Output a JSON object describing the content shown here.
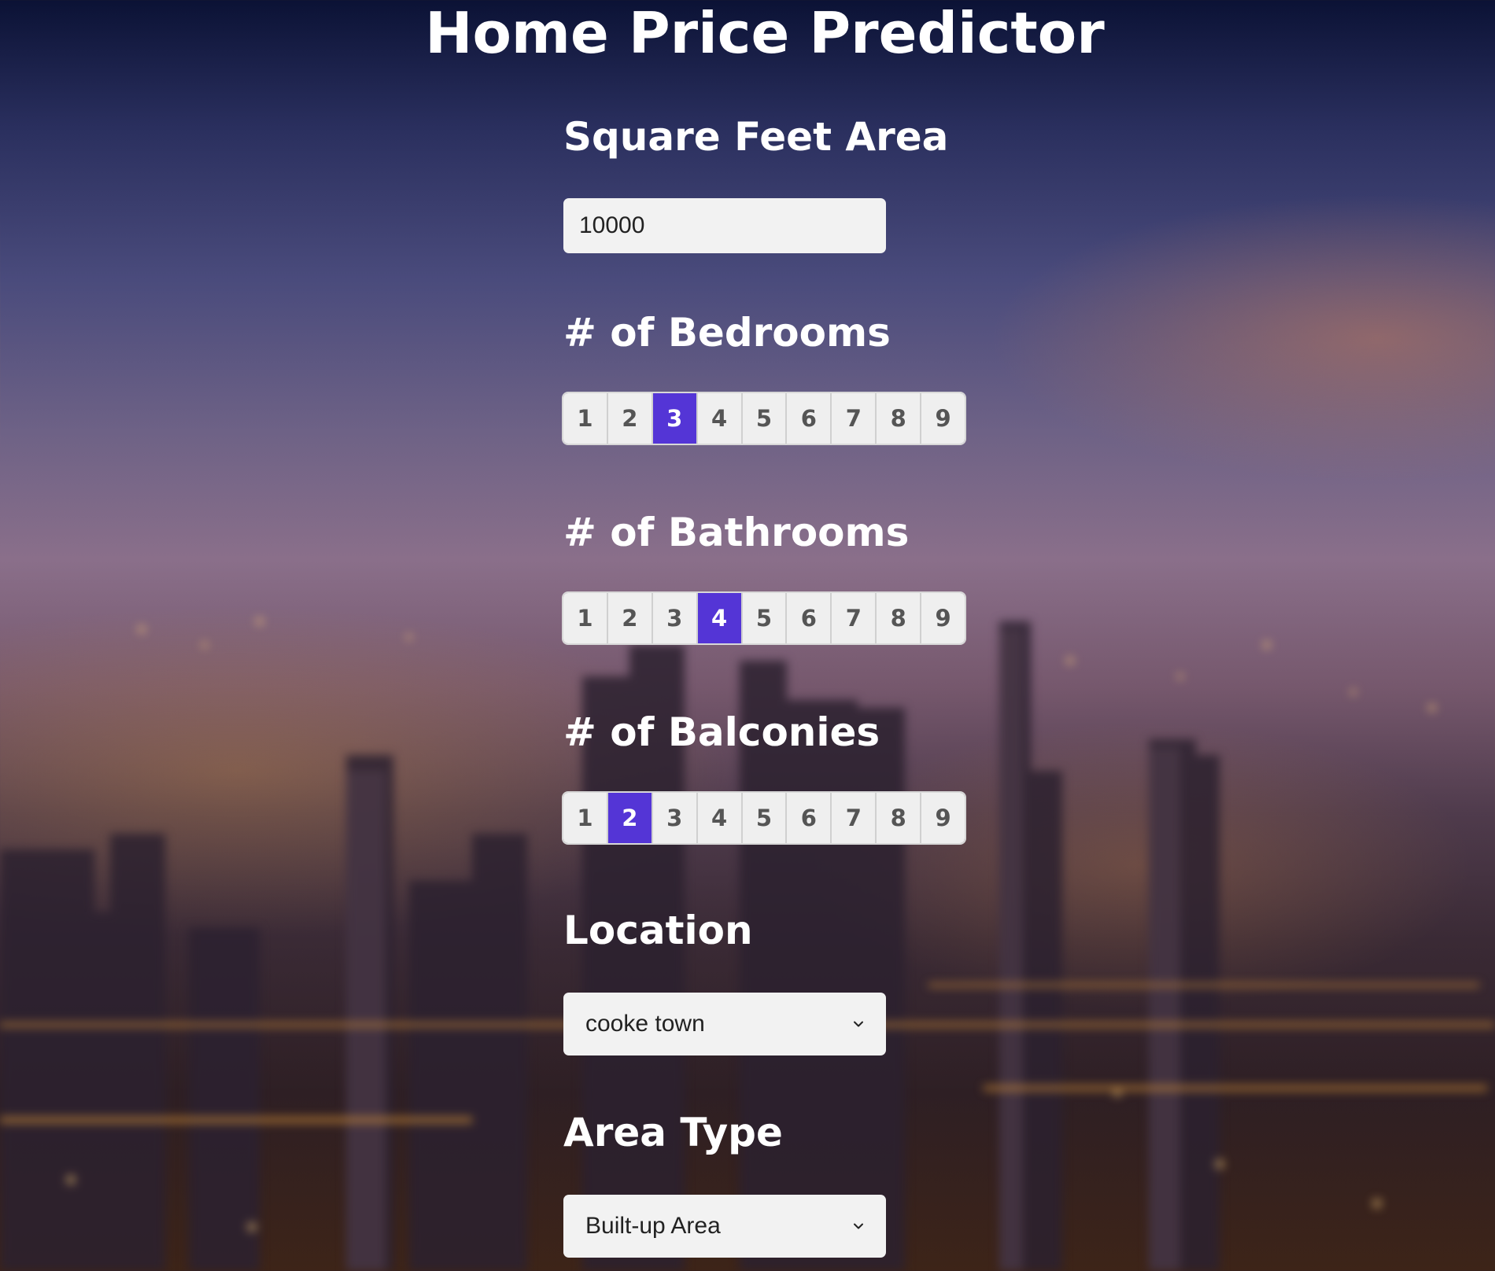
{
  "page": {
    "title": "Home Price Predictor"
  },
  "square_feet": {
    "label": "Square Feet Area",
    "value": "10000"
  },
  "bedrooms": {
    "label": "# of Bedrooms",
    "options": [
      "1",
      "2",
      "3",
      "4",
      "5",
      "6",
      "7",
      "8",
      "9"
    ],
    "selected": "3"
  },
  "bathrooms": {
    "label": "# of Bathrooms",
    "options": [
      "1",
      "2",
      "3",
      "4",
      "5",
      "6",
      "7",
      "8",
      "9"
    ],
    "selected": "4"
  },
  "balconies": {
    "label": "# of Balconies",
    "options": [
      "1",
      "2",
      "3",
      "4",
      "5",
      "6",
      "7",
      "8",
      "9"
    ],
    "selected": "2"
  },
  "location": {
    "label": "Location",
    "selected": "cooke town"
  },
  "area_type": {
    "label": "Area Type",
    "selected": "Built-up Area"
  },
  "colors": {
    "accent": "#5435d6",
    "field_background": "#f2f2f2",
    "text_on_background": "#ffffff"
  },
  "icons": {
    "dropdown": "chevron-down-icon"
  },
  "background": {
    "subject": "blurred night city skyline"
  }
}
